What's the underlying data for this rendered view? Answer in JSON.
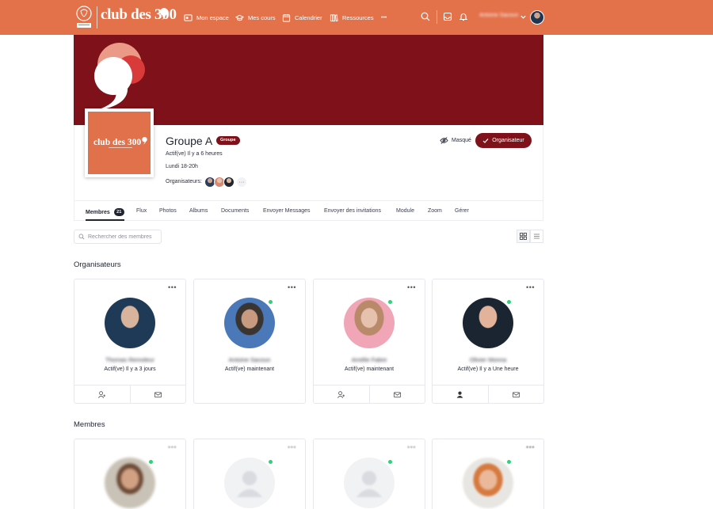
{
  "topbar": {
    "brand_text": "club des 300",
    "nav": [
      {
        "label": "Mon espace",
        "icon": "dashboard-icon"
      },
      {
        "label": "Mes cours",
        "icon": "graduation-cap-icon"
      },
      {
        "label": "Calendrier",
        "icon": "calendar-icon"
      },
      {
        "label": "Ressources",
        "icon": "books-icon"
      }
    ],
    "more_label": "•••",
    "user_name": "Antoine Sacoun",
    "colors": {
      "bar": "#e3714a",
      "accent": "#7e1119"
    }
  },
  "group": {
    "title": "Groupe A",
    "badge": "Groupe",
    "activity": "Actif(ve) Il y a 6 heures",
    "schedule": "Lundi 18-20h",
    "organizers_label": "Organisateurs:",
    "organizers_more": "···",
    "avatar_text": "club des 300",
    "hidden_label": "Masqué",
    "role_button": "Organisateur"
  },
  "tabs": [
    {
      "label": "Membres",
      "count": "21",
      "active": true
    },
    {
      "label": "Flux"
    },
    {
      "label": "Photos"
    },
    {
      "label": "Albums"
    },
    {
      "label": "Documents"
    },
    {
      "label": "Envoyer Messages"
    },
    {
      "label": "Envoyer des invitations"
    },
    {
      "label": "Module"
    },
    {
      "label": "Zoom"
    },
    {
      "label": "Gérer"
    }
  ],
  "search": {
    "placeholder": "Rechercher des membres"
  },
  "sections": {
    "organizers": "Organisateurs",
    "members": "Membres"
  },
  "organizers": [
    {
      "name": "Thomas Remoleur",
      "status": "Actif(ve) Il y a 3 jours",
      "online": false
    },
    {
      "name": "Antoine Sacoun",
      "status": "Actif(ve) maintenant",
      "online": true
    },
    {
      "name": "Amélie Fabre",
      "status": "Actif(ve) maintenant",
      "online": true
    },
    {
      "name": "Olivier Monna",
      "status": "Actif(ve) Il y a Une heure",
      "online": true
    }
  ],
  "card_more_label": "•••"
}
